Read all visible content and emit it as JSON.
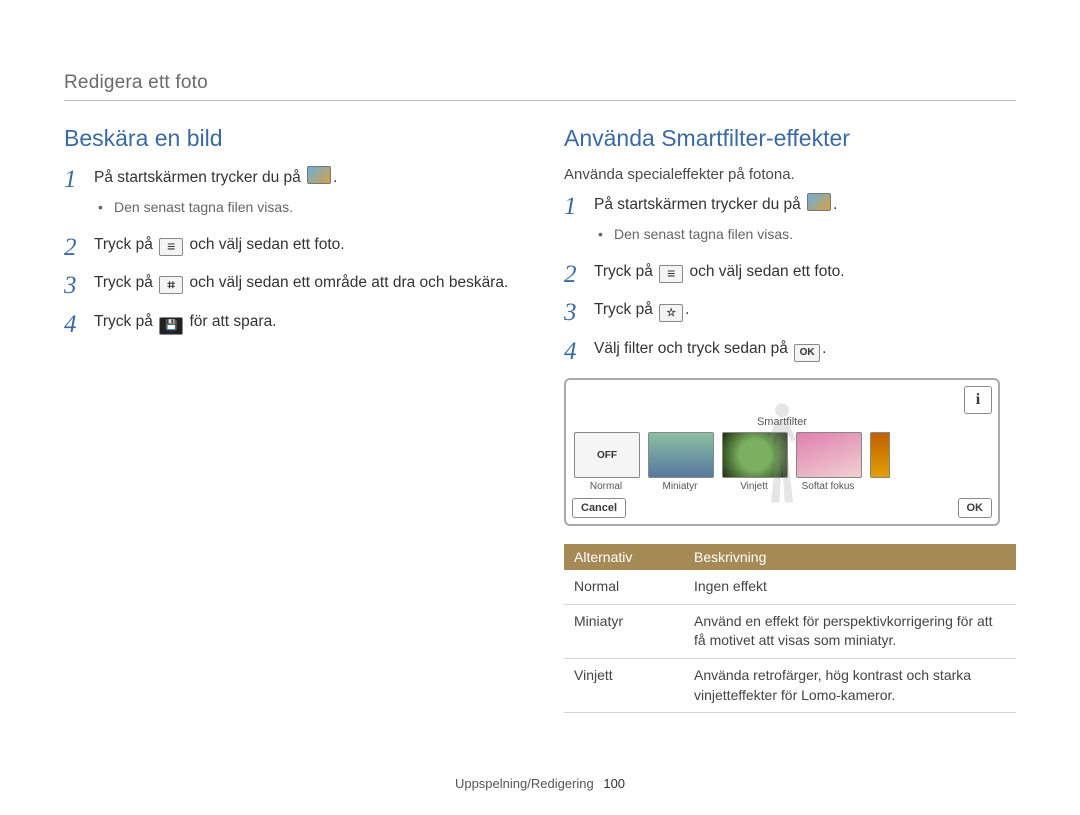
{
  "header": "Redigera ett foto",
  "left": {
    "title": "Beskära en bild",
    "steps": [
      {
        "pre": "På startskärmen trycker du på ",
        "icon": "gallery",
        "post": ".",
        "subs": [
          "Den senast tagna filen visas."
        ]
      },
      {
        "pre": "Tryck på ",
        "icon": "menu",
        "post": " och välj sedan ett foto."
      },
      {
        "pre": "Tryck på ",
        "icon": "crop",
        "post": " och välj sedan ett område att dra och beskära."
      },
      {
        "pre": "Tryck på ",
        "icon": "save",
        "post": " för att spara."
      }
    ]
  },
  "right": {
    "title": "Använda Smartfilter-effekter",
    "intro": "Använda specialeffekter på fotona.",
    "steps": [
      {
        "pre": "På startskärmen trycker du på ",
        "icon": "gallery",
        "post": ".",
        "subs": [
          "Den senast tagna filen visas."
        ]
      },
      {
        "pre": "Tryck på ",
        "icon": "menu",
        "post": " och välj sedan ett foto."
      },
      {
        "pre": "Tryck på ",
        "icon": "smart",
        "post": "."
      },
      {
        "pre": "Välj filter och tryck sedan på ",
        "icon": "ok",
        "post": "."
      }
    ],
    "device": {
      "title": "Smartfilter",
      "offLabel": "OFF",
      "thumbs": [
        "Normal",
        "Miniatyr",
        "Vinjett",
        "Softat fokus"
      ],
      "cancel": "Cancel",
      "ok": "OK"
    },
    "table": {
      "headers": [
        "Alternativ",
        "Beskrivning"
      ],
      "rows": [
        [
          "Normal",
          "Ingen effekt"
        ],
        [
          "Miniatyr",
          "Använd en effekt för perspektivkorrigering för att få motivet att visas som miniatyr."
        ],
        [
          "Vinjett",
          "Använda retrofärger, hög kontrast och starka vinjetteffekter för Lomo-kameror."
        ]
      ]
    }
  },
  "footer": {
    "section": "Uppspelning/Redigering",
    "page": "100"
  }
}
